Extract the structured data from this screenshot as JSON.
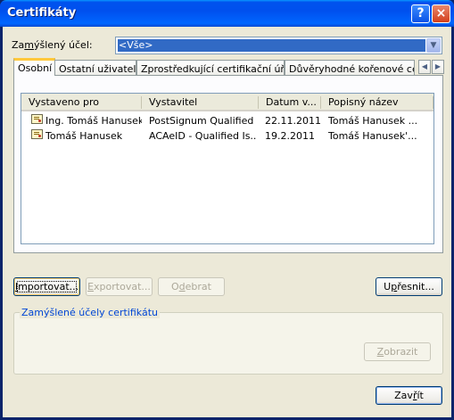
{
  "window": {
    "title": "Certifikáty",
    "help_button": "?",
    "close_button": "×"
  },
  "purpose": {
    "label_pre": "Za",
    "label_u": "m",
    "label_post": "ýšlený účel:",
    "selected": "<Vše>",
    "dropdown_icon": "chevron-down-icon"
  },
  "tabs": [
    {
      "label": "Osobní",
      "active": true
    },
    {
      "label": "Ostatní uživatelé"
    },
    {
      "label": "Zprostředkující certifikační úřady"
    },
    {
      "label": "Důvěryhodné kořenové cert"
    }
  ],
  "tab_scroll": {
    "left": "◀",
    "right": "▶"
  },
  "list": {
    "columns": [
      "Vystaveno pro",
      "Vystavitel",
      "Datum v...",
      "Popisný název"
    ],
    "rows": [
      {
        "issued_to": "Ing. Tomáš Hanusek",
        "issuer": "PostSignum Qualified ...",
        "date": "22.11.2011",
        "friendly": "Tomáš Hanusek ..."
      },
      {
        "issued_to": "Tomáš Hanusek",
        "issuer": "ACAeID - Qualified Is...",
        "date": "19.2.2011",
        "friendly": "Tomáš Hanusek'..."
      }
    ]
  },
  "buttons": {
    "import": {
      "u": "I",
      "rest": "mportovat..."
    },
    "export": {
      "u": "E",
      "rest": "xportovat..."
    },
    "remove": {
      "pre": "O",
      "u": "d",
      "post": "ebrat"
    },
    "advanced": {
      "pre": "U",
      "u": "p",
      "post": "řesnit..."
    },
    "view": {
      "u": "Z",
      "rest": "obrazit"
    },
    "close": {
      "pre": "Zav",
      "u": "ř",
      "post": "ít"
    }
  },
  "group": {
    "title": "Zamýšlené účely certifikátu"
  }
}
